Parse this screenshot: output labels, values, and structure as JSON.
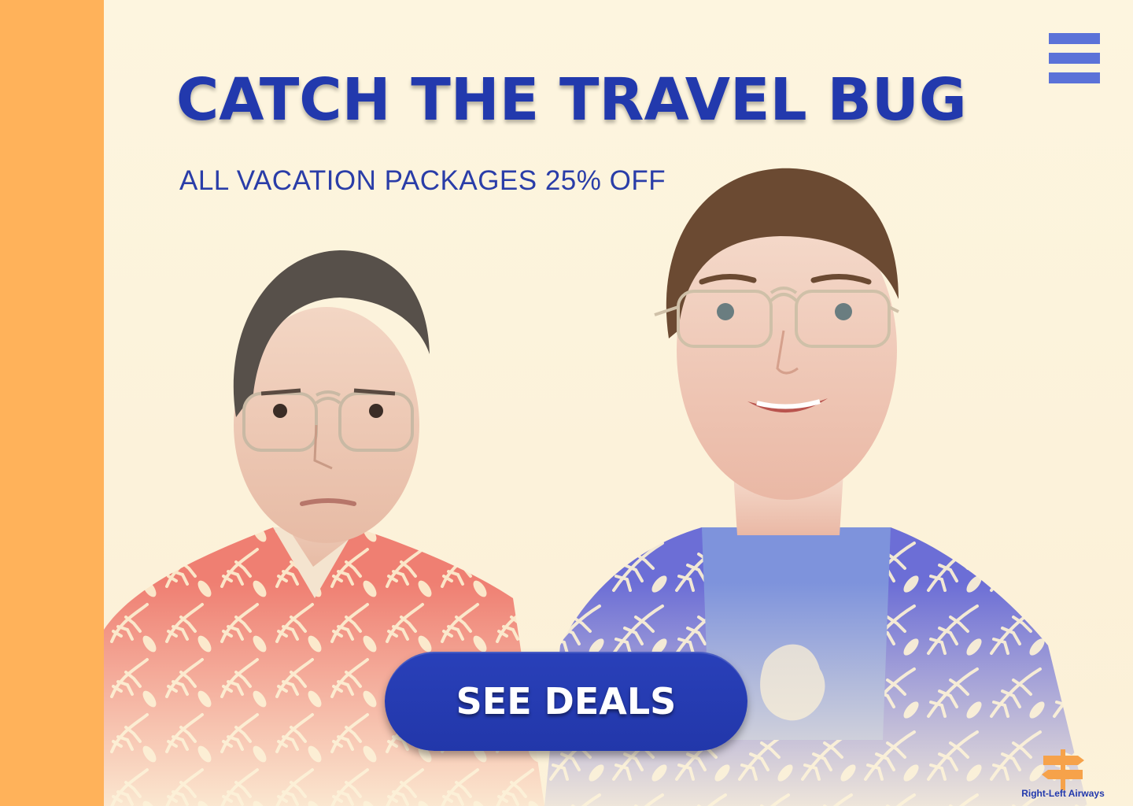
{
  "hero": {
    "headline": "CATCH THE TRAVEL BUG",
    "subheadline": "ALL VACATION PACKAGES 25% OFF",
    "cta_label": "SEE DEALS"
  },
  "brand": {
    "name": "Right-Left Airways",
    "logo_icon": "signpost-icon"
  },
  "nav": {
    "menu_icon": "hamburger-menu-icon"
  },
  "colors": {
    "accent_blue": "#2239ad",
    "menu_blue": "#5b72d8",
    "side_stripe": "#ffb25a",
    "background": "#fcf4de",
    "woman_shirt": "#ef7f72",
    "man_shirt": "#6c6ed6"
  }
}
